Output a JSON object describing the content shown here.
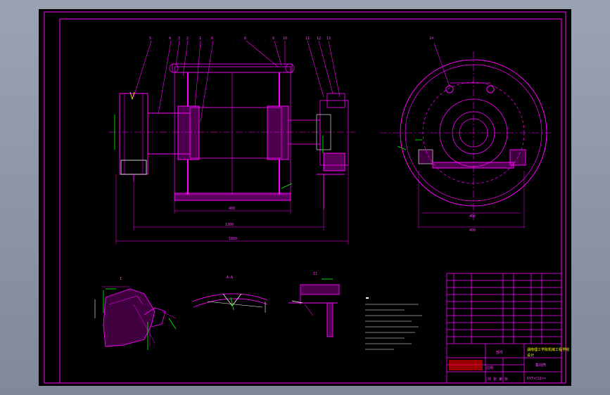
{
  "colors": {
    "background_outer": "#8e98a8",
    "canvas": "#000000",
    "primary_line": "#ff00ff",
    "secondary_line": "#ffffff",
    "accent_yellow": "#ffff00",
    "accent_green": "#00ff00",
    "accent_red": "#ff0000"
  },
  "drawing": {
    "dimensions": {
      "inner_width": "1300",
      "total_width": "1800",
      "wheel_width": "400"
    },
    "detail_tags": {
      "detail_1": "I",
      "detail_2": "II"
    },
    "title_block": {
      "drawing_number": "DYT×CS1××",
      "company_line_1": "湖南理工学院机械工程学院",
      "company_line_2": "设计",
      "part_name": "集线筒",
      "scale_label": "比例",
      "sheet_label": "共 张 第 张"
    }
  },
  "icons": {
    "detail_view": "section-detail-icon",
    "dimension": "dimension-arrow-icon"
  }
}
